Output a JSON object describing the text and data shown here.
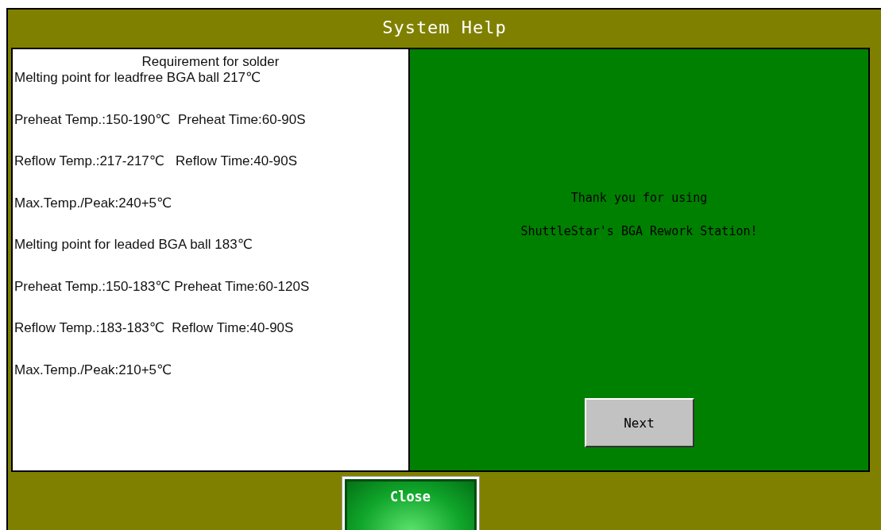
{
  "window": {
    "title": "System Help"
  },
  "requirements": {
    "heading": "Requirement for solder",
    "lines": [
      "Melting point for leadfree BGA ball 217℃",
      "Preheat Temp.:150-190℃  Preheat Time:60-90S",
      "Reflow Temp.:217-217℃   Reflow Time:40-90S",
      "Max.Temp./Peak:240+5℃",
      "Melting point for leaded BGA ball 183℃",
      "Preheat Temp.:150-183℃ Preheat Time:60-120S",
      "Reflow Temp.:183-183℃  Reflow Time:40-90S",
      "Max.Temp./Peak:210+5℃"
    ]
  },
  "message": {
    "lines": [
      "Thank you for using",
      "ShuttleStar's BGA Rework Station!"
    ],
    "button": "Next"
  },
  "close_button": "Close"
}
